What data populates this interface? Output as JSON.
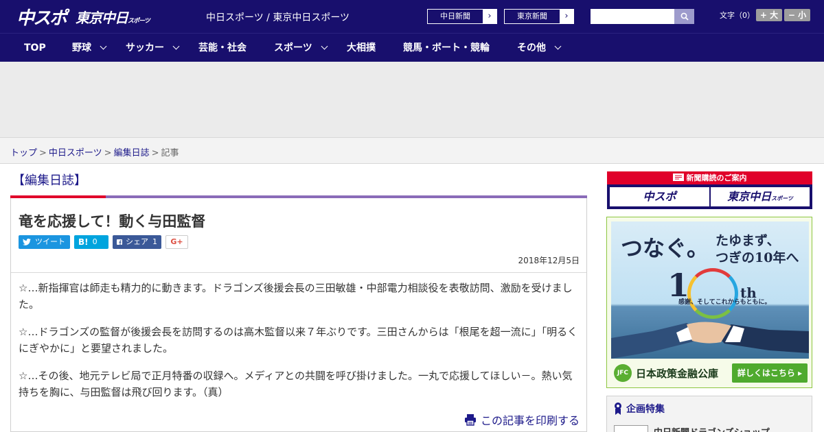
{
  "header": {
    "logo_chuspo": "中スポ",
    "logo_tokyo": "東京中日",
    "logo_tokyo_small": "スポーツ",
    "site_desc": "中日スポーツ / 東京中日スポーツ",
    "ext_links": [
      {
        "label": "中日新聞",
        "arrow": "›"
      },
      {
        "label": "東京新聞",
        "arrow": "›"
      }
    ],
    "search": {
      "placeholder": "",
      "value": ""
    },
    "fontsize_label": "文字（0）",
    "fontsize_up": "+ 大",
    "fontsize_down": "− 小",
    "colors": {
      "brand": "#180f6d",
      "accent_red": "#e0002a"
    }
  },
  "nav": [
    {
      "label": "TOP",
      "has_dropdown": false
    },
    {
      "label": "野球",
      "has_dropdown": true
    },
    {
      "label": "サッカー",
      "has_dropdown": true
    },
    {
      "label": "芸能・社会",
      "has_dropdown": false
    },
    {
      "label": "スポーツ",
      "has_dropdown": true
    },
    {
      "label": "大相撲",
      "has_dropdown": false
    },
    {
      "label": "競馬・ボート・競輪",
      "has_dropdown": false
    },
    {
      "label": "その他",
      "has_dropdown": true
    }
  ],
  "breadcrumb": {
    "items": [
      "トップ",
      "中日スポーツ",
      "編集日誌"
    ],
    "current": "記事",
    "sep": ">"
  },
  "article": {
    "section": "【編集日誌】",
    "headline": "竜を応援して！動く与田監督",
    "share": {
      "tweet": "ツイート",
      "hatena_logo": "B!",
      "hatena_count": "0",
      "facebook": "シェア",
      "facebook_count": "1",
      "gplus": "G+"
    },
    "date": "2018年12月5日",
    "paragraphs": [
      "☆…新指揮官は師走も精力的に動きます。ドラゴンズ後援会長の三田敏雄・中部電力相談役を表敬訪問、激励を受けました。",
      "☆…ドラゴンズの監督が後援会長を訪問するのは高木監督以来７年ぶりです。三田さんからは「根尾を超一流に」「明るくにぎやかに」と要望されました。",
      "☆…その後、地元テレビ局で正月特番の収録へ。メディアとの共闘を呼び掛けました。一丸で応援してほしい－。熱い気持ちを胸に、与田監督は飛び回ります。（真）"
    ],
    "print": "この記事を印刷する"
  },
  "sidebar": {
    "subscription": {
      "heading": "新聞購読のご案内",
      "logo1": "中スポ",
      "logo2": "東京中日",
      "logo2_small": "スポーツ"
    },
    "ad": {
      "line1": "つなぐ。",
      "line2a": "たゆまず、",
      "line2b": "つぎの10年へ",
      "ten": "1",
      "th": "th",
      "slogan": "感謝、そしてこれからもともに。",
      "badge": "JFC",
      "org": "日本政策金融公庫",
      "button": "詳しくはこちら ▸"
    },
    "features": {
      "title": "企画特集",
      "first_item": "中日新聞ドラゴンズショップ"
    }
  }
}
